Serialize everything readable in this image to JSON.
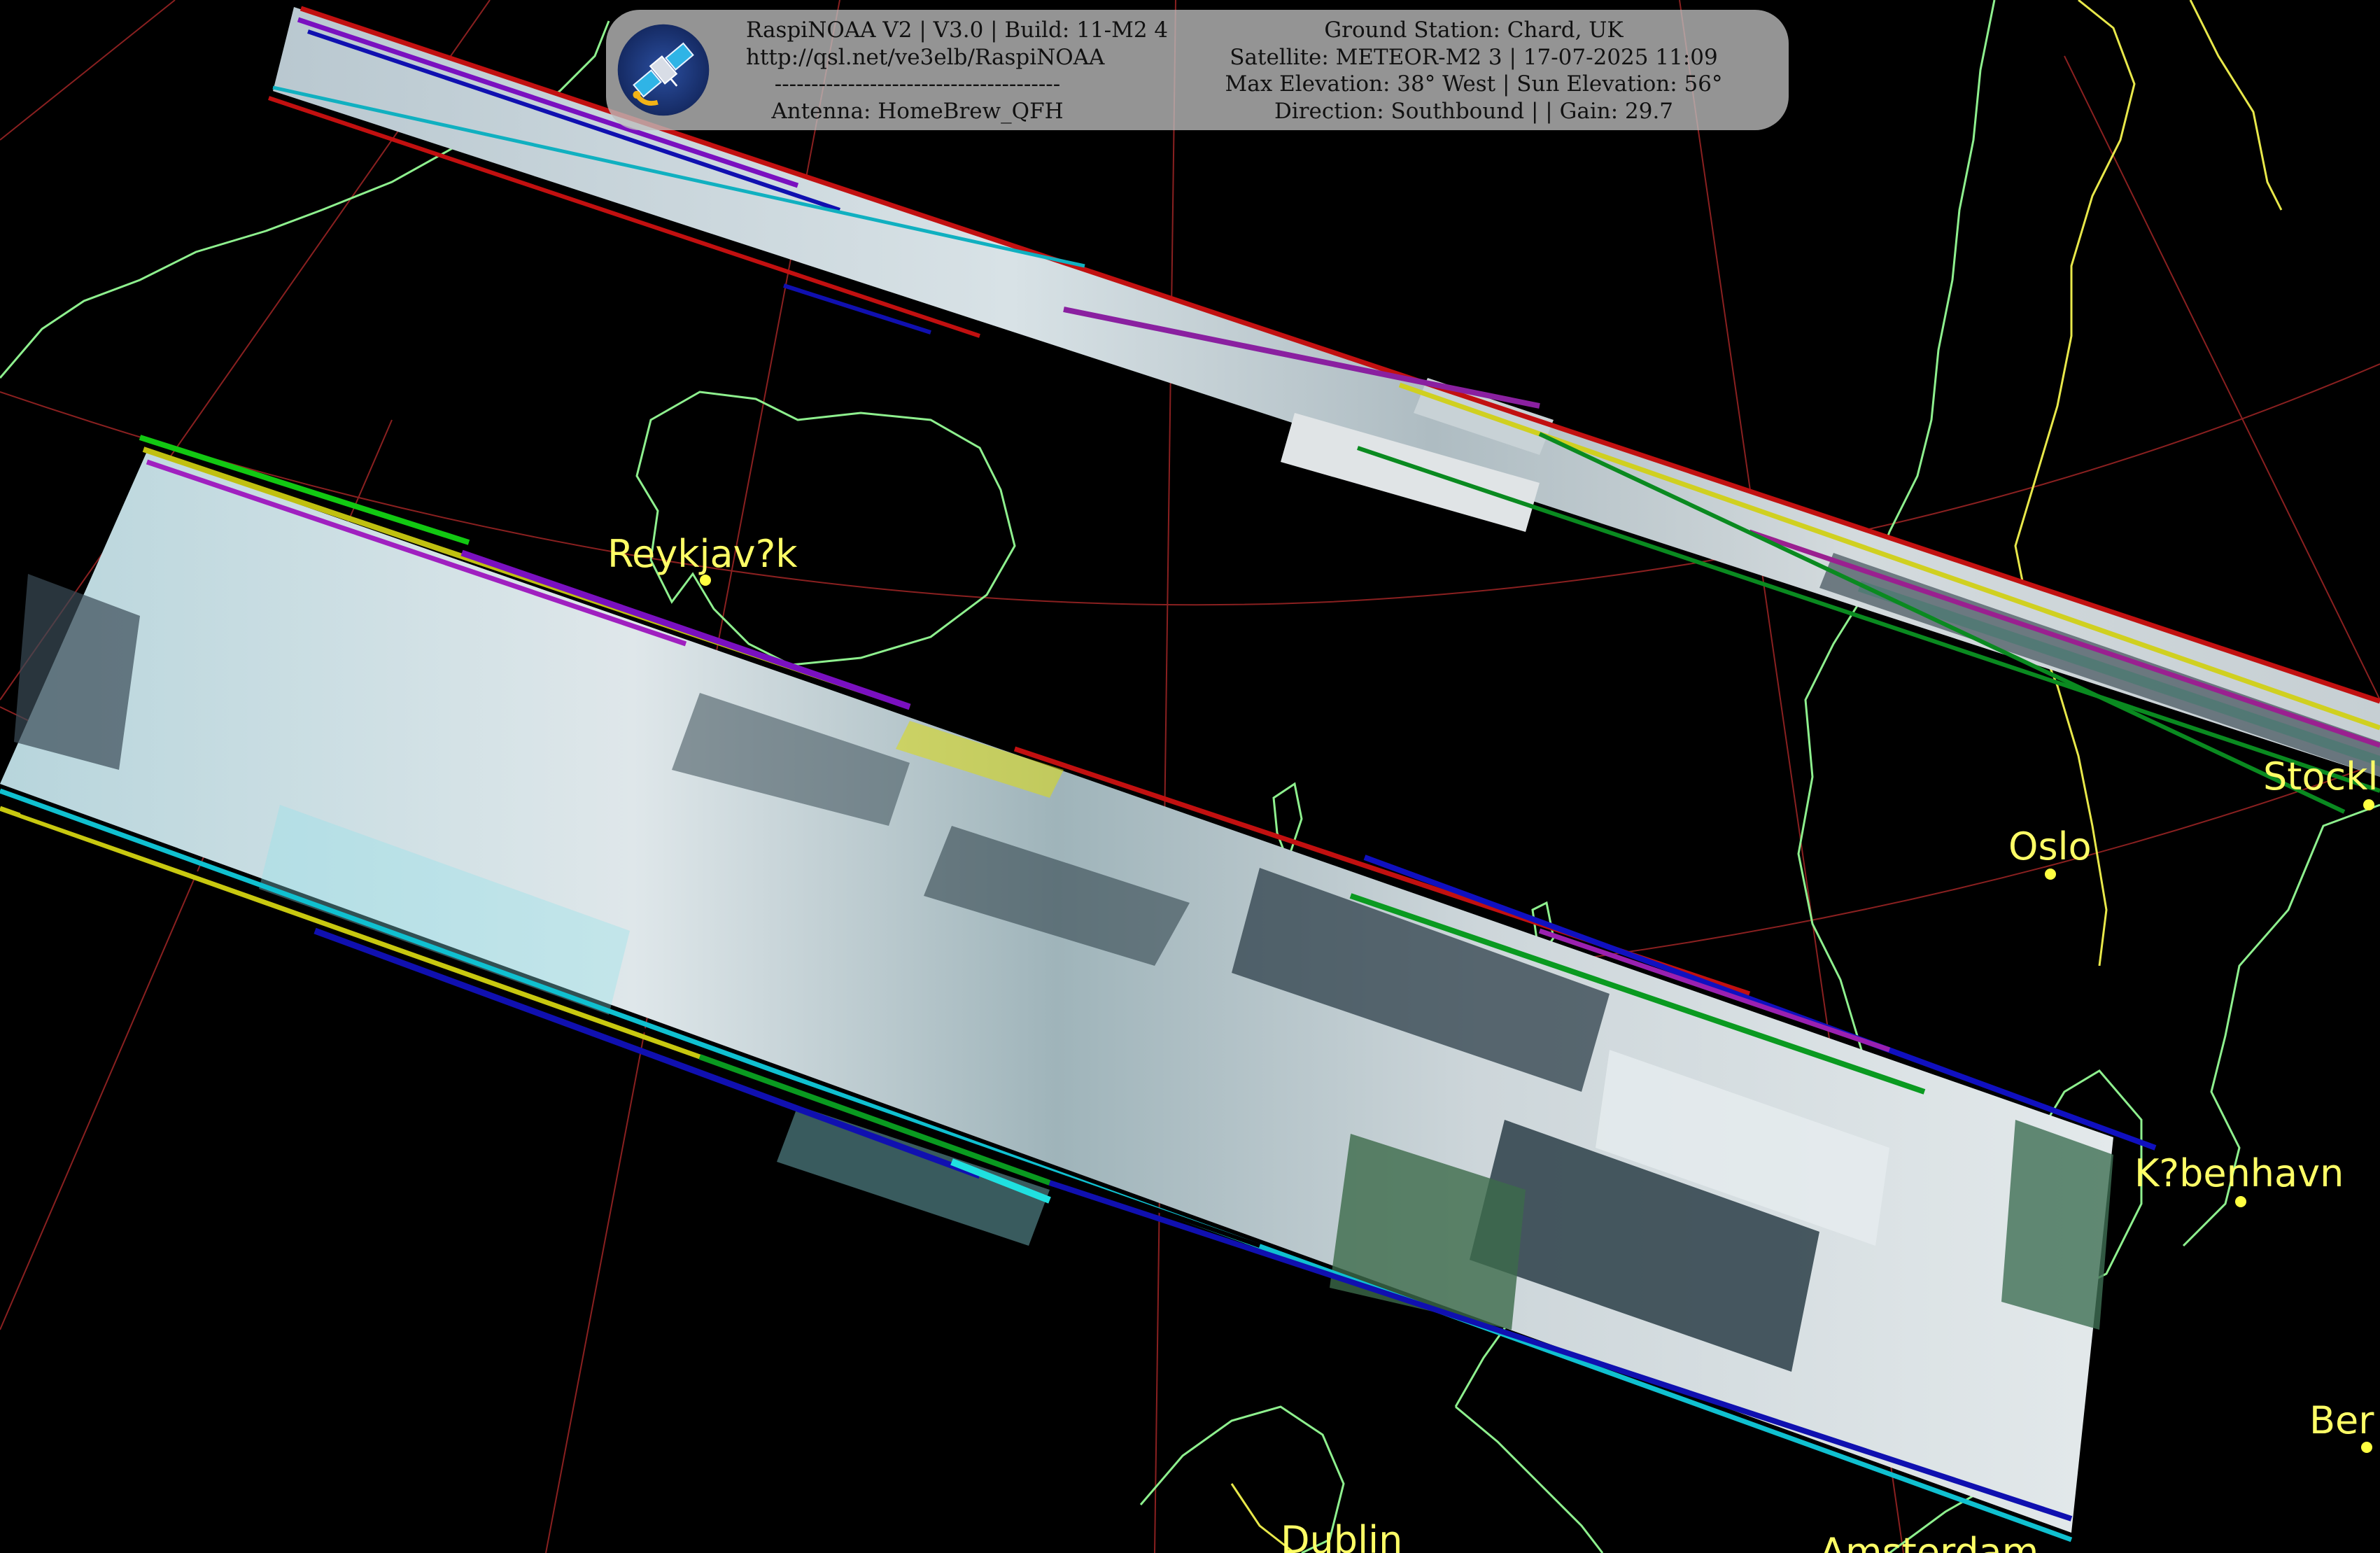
{
  "banner": {
    "left_lines": [
      "RaspiNOAA V2 | V3.0 | Build: 11-M2 4",
      "http://qsl.net/ve3elb/RaspiNOAA",
      "---------------------------------------",
      "Antenna: HomeBrew_QFH"
    ],
    "right_lines": [
      "Ground Station: Chard, UK",
      "Satellite: METEOR-M2 3 | 17-07-2025 11:09",
      "Max Elevation: 38° West | Sun Elevation: 56°",
      "Direction: Southbound | | Gain: 29.7"
    ],
    "logo_icon": "satellite-icon"
  },
  "cities": [
    {
      "name": "Reykjav?k"
    },
    {
      "name": "Oslo"
    },
    {
      "name": "Stockl"
    },
    {
      "name": "K?benhavn"
    },
    {
      "name": "Ber"
    },
    {
      "name": "Dublin"
    },
    {
      "name": "Amsterdam"
    }
  ],
  "colors": {
    "background": "#000000",
    "coastline": "#8ef08e",
    "border": "#e8e84a",
    "graticule": "#8a2020",
    "city_label": "#ffff66",
    "cloud": "#cfd8dc",
    "ocean_imagery": "#2c3e48"
  }
}
